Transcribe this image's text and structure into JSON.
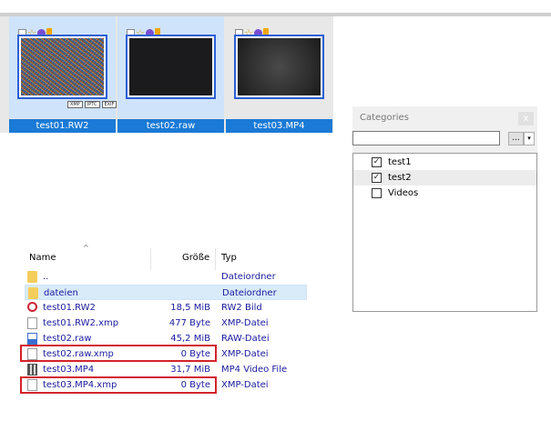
{
  "thumbnails": [
    {
      "caption": "test01.RW2",
      "image": "noise",
      "badges": [
        "XMP",
        "IPTC",
        "EXIF"
      ],
      "selected": true
    },
    {
      "caption": "test02.raw",
      "image": "dark",
      "badges": [],
      "selected": true
    },
    {
      "caption": "test03.MP4",
      "image": "video-still",
      "badges": [],
      "selected": false
    }
  ],
  "categories": {
    "title": "Categories",
    "close_label": "x",
    "search_value": "",
    "more_label": "...",
    "dropdown_label": "▾",
    "items": [
      {
        "label": "test1",
        "checked": true
      },
      {
        "label": "test2",
        "checked": true
      },
      {
        "label": "Videos",
        "checked": false
      }
    ]
  },
  "file_list": {
    "columns": {
      "name": "Name",
      "size": "Größe",
      "type": "Typ"
    },
    "rows": [
      {
        "name": "..",
        "size": "",
        "type": "Dateiordner",
        "icon": "folder-icon"
      },
      {
        "name": "dateien",
        "size": "",
        "type": "Dateiordner",
        "icon": "folder-icon"
      },
      {
        "name": "test01.RW2",
        "size": "18,5 MiB",
        "type": "RW2 Bild",
        "icon": "raw-image-icon"
      },
      {
        "name": "test01.RW2.xmp",
        "size": "477 Byte",
        "type": "XMP-Datei",
        "icon": "document-icon"
      },
      {
        "name": "test02.raw",
        "size": "45,2 MiB",
        "type": "RAW-Datei",
        "icon": "raw-file-icon"
      },
      {
        "name": "test02.raw.xmp",
        "size": "0 Byte",
        "type": "XMP-Datei",
        "icon": "document-icon"
      },
      {
        "name": "test03.MP4",
        "size": "31,7 MiB",
        "type": "MP4 Video File",
        "icon": "video-file-icon"
      },
      {
        "name": "test03.MP4.xmp",
        "size": "0 Byte",
        "type": "XMP-Datei",
        "icon": "document-icon"
      }
    ]
  }
}
